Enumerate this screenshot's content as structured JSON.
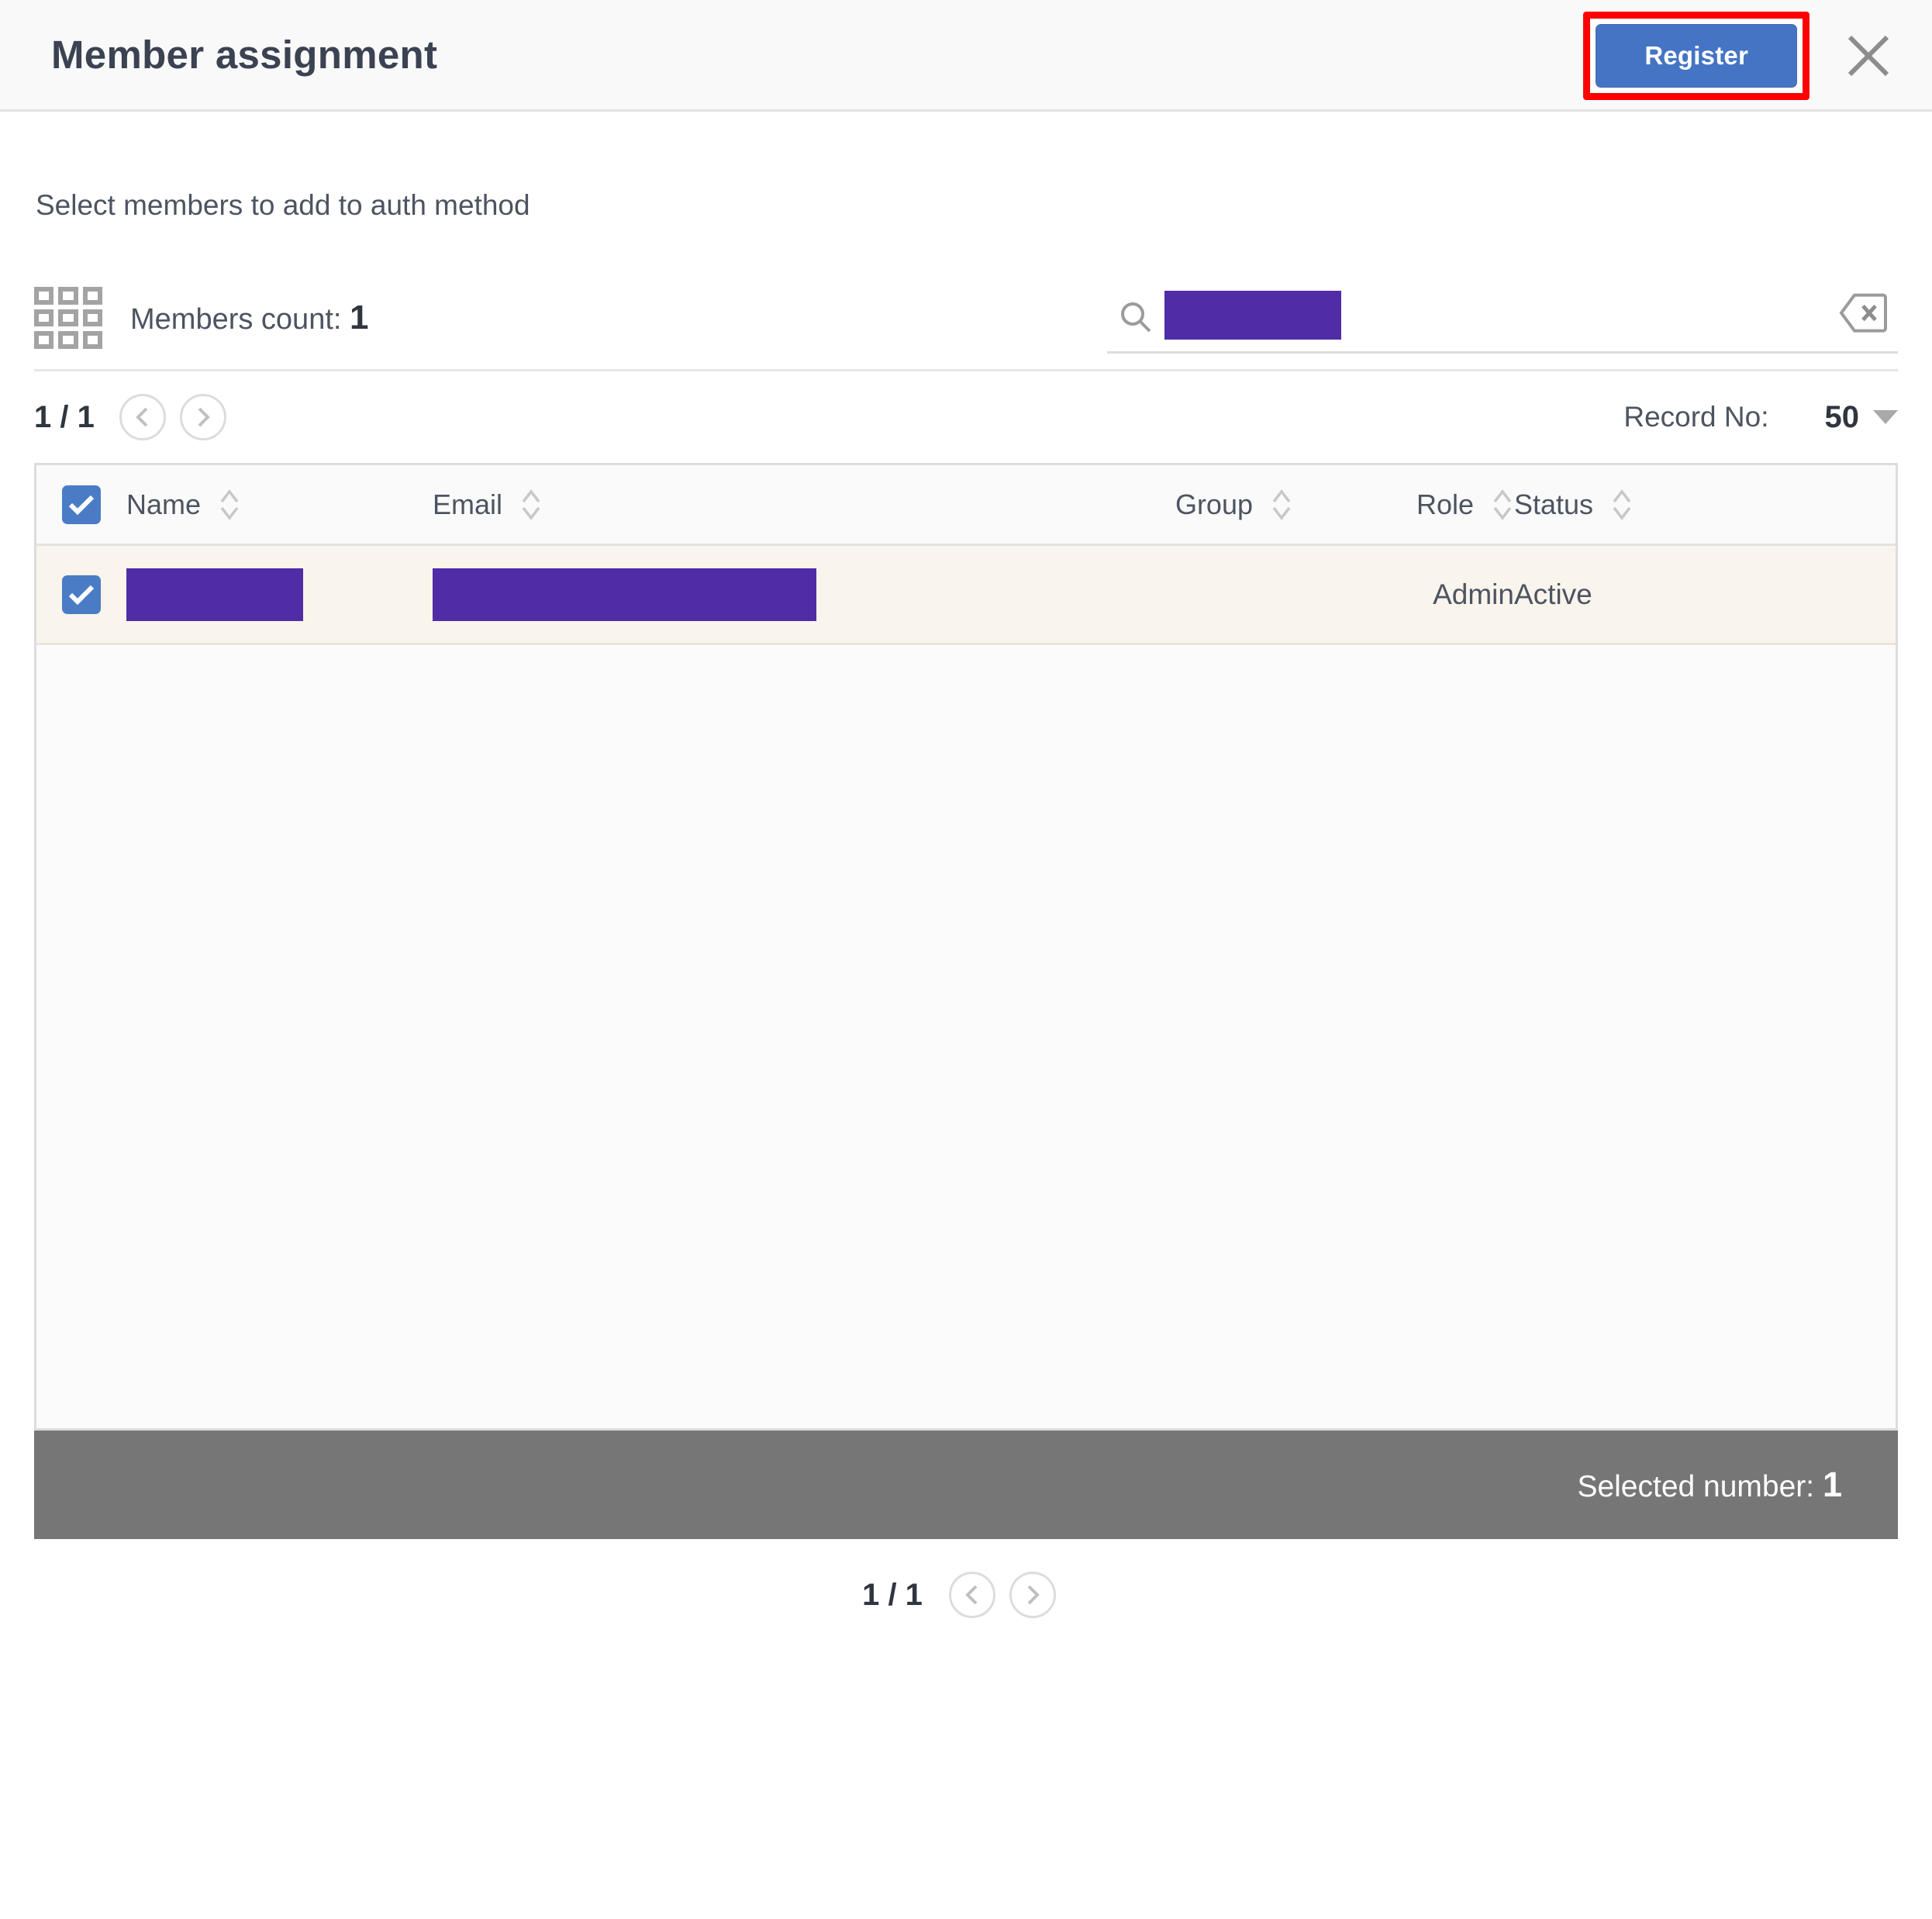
{
  "header": {
    "title": "Member assignment",
    "register_label": "Register",
    "close_icon": "close-icon",
    "highlight_color": "#fe0000",
    "register_color": "#4574c4"
  },
  "body": {
    "subtitle": "Select members to add to auth method",
    "members_count_label": "Members count:",
    "members_count_value": "1",
    "grid_icon": "grid-icon"
  },
  "search": {
    "icon": "search-icon",
    "value": "",
    "placeholder": "",
    "redacted": true,
    "clear_icon": "backspace-clear-icon"
  },
  "pager_top": {
    "page_text": "1 / 1",
    "prev_icon": "chevron-left-icon",
    "next_icon": "chevron-right-icon"
  },
  "record_no": {
    "label": "Record No:",
    "value": "50",
    "caret_icon": "chevron-down-icon"
  },
  "table": {
    "select_all_checked": true,
    "columns": [
      {
        "label": "Name",
        "sortable": true
      },
      {
        "label": "Email",
        "sortable": true
      },
      {
        "label": "Group",
        "sortable": true
      },
      {
        "label": "Role",
        "sortable": true
      },
      {
        "label": "Status",
        "sortable": true
      }
    ],
    "rows": [
      {
        "checked": true,
        "name": "",
        "name_redacted": true,
        "email": "",
        "email_redacted": true,
        "group": "",
        "role": "Admin",
        "status": "Active"
      }
    ],
    "row_highlight_color": "#f9f4ec",
    "redaction_color": "#502ca7"
  },
  "selected_bar": {
    "label": "Selected number:",
    "value": "1",
    "background": "#767676"
  },
  "pager_bottom": {
    "page_text": "1 / 1",
    "prev_icon": "chevron-left-icon",
    "next_icon": "chevron-right-icon"
  }
}
